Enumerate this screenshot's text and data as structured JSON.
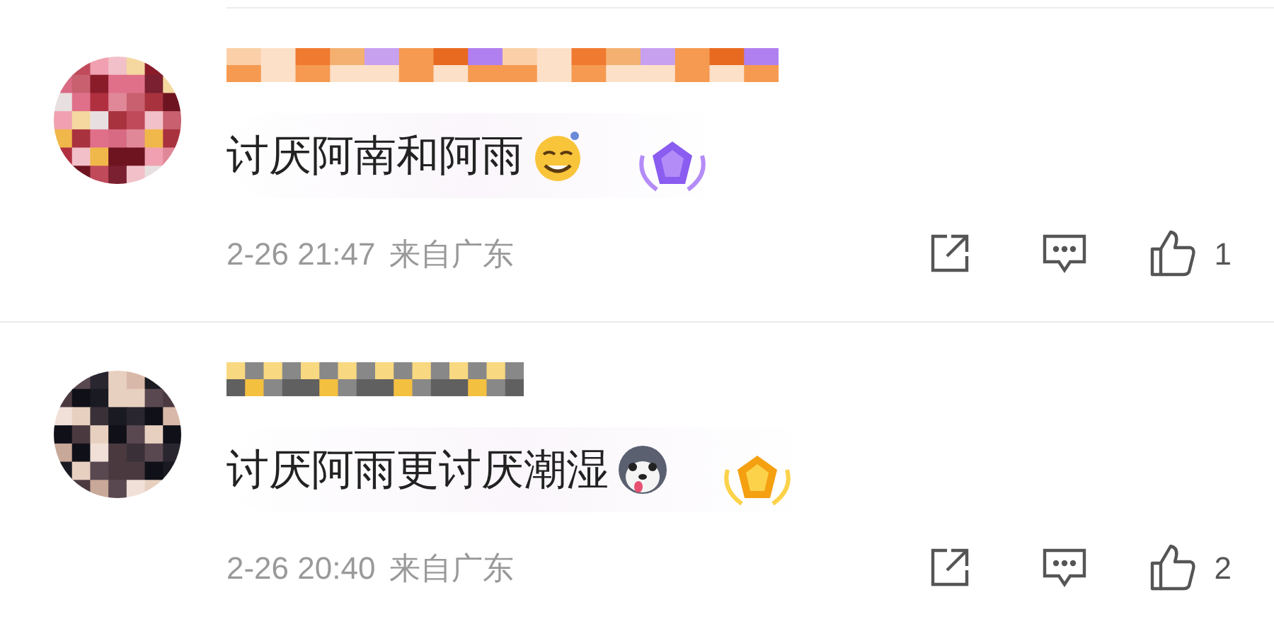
{
  "comments": [
    {
      "text": "讨厌阿南和阿雨",
      "emoji": {
        "kind": "sweat"
      },
      "badge": {
        "kind": "purple"
      },
      "time": "2-26 21:47",
      "location": "来自广东",
      "likes": "1"
    },
    {
      "text": "讨厌阿雨更讨厌潮湿",
      "emoji": {
        "kind": "husky"
      },
      "badge": {
        "kind": "gold"
      },
      "time": "2-26 20:40",
      "location": "来自广东",
      "likes": "2"
    }
  ]
}
